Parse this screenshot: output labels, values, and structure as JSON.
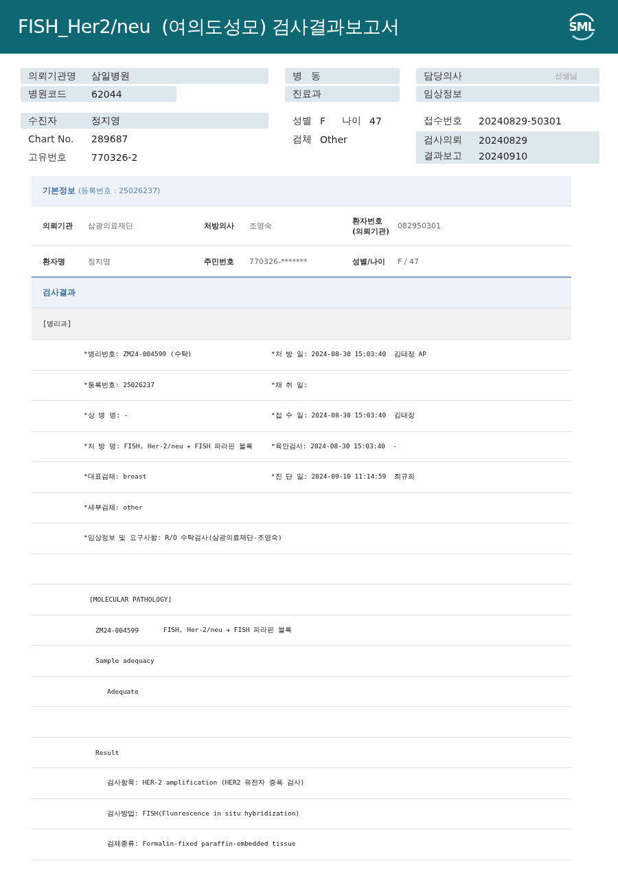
{
  "header": {
    "title": "FISH_Her2/neu  (여의도성모) 검사결과보고서",
    "logo": "SML"
  },
  "info": {
    "columns": [
      [
        {
          "kind": "pill",
          "pairs": [
            {
              "label": "의뢰기관명",
              "value": "삼일병원"
            }
          ]
        },
        {
          "kind": "short-pill",
          "pairs": [
            {
              "label": "병원코드",
              "value": "62044"
            }
          ]
        },
        {
          "kind": "pill",
          "pairs": [
            {
              "label": "수진자",
              "value": "정지영"
            }
          ]
        },
        {
          "kind": "plain",
          "pairs": [
            {
              "label": "Chart No.",
              "value": "289687"
            }
          ]
        },
        {
          "kind": "plain",
          "pairs": [
            {
              "label": "고유번호",
              "value": "770326-2"
            }
          ]
        }
      ],
      [
        {
          "kind": "pill",
          "pairs": [
            {
              "label": "병   동"
            }
          ]
        },
        {
          "kind": "pill",
          "pairs": [
            {
              "label": "진료과"
            }
          ]
        },
        {
          "kind": "plain",
          "pairs": [
            {
              "label": "성별",
              "value": "F"
            },
            {
              "label": "나이",
              "value": "47"
            }
          ]
        },
        {
          "kind": "plain",
          "pairs": [
            {
              "label": "검체",
              "value": "Other"
            }
          ]
        }
      ],
      [
        {
          "kind": "pill",
          "pairs": [
            {
              "label": "담당의사"
            }
          ],
          "note": "선생님"
        },
        {
          "kind": "pill",
          "pairs": [
            {
              "label": "임상정보"
            }
          ]
        },
        {
          "kind": "plain",
          "pairs": [
            {
              "label": "접수번호",
              "value": "20240829-50301"
            }
          ]
        },
        {
          "kind": "pill-group",
          "pairs": [
            {
              "label": "검사의뢰",
              "value": "20240829"
            },
            {
              "label": "결과보고",
              "value": "20240910"
            }
          ]
        }
      ]
    ]
  },
  "basic": {
    "title": "기본정보",
    "subtitle": "(등록번호 : 25026237)",
    "rows": [
      [
        {
          "label": "의뢰기관",
          "value": "삼광의료재단"
        },
        {
          "label": "처방의사",
          "value": "조영숙"
        },
        {
          "label": "환자번호 (의뢰기관)",
          "value": "082950301"
        }
      ],
      [
        {
          "label": "환자명",
          "value": "정지영"
        },
        {
          "label": "주민번호",
          "value": "770326-*******"
        },
        {
          "label": "성별/나이",
          "value": "F / 47"
        }
      ]
    ]
  },
  "results": {
    "title": "검사결과",
    "department": "[병리과]",
    "lines": [
      {
        "kind": "field",
        "texts": [
          "*병리번호: ZM24-004599 (수탁)",
          "*처 방 일: 2024-08-30 15:03:40  김태정 AP"
        ]
      },
      {
        "kind": "field",
        "texts": [
          "*등록번호: 25026237",
          "*채 취 일:"
        ]
      },
      {
        "kind": "field",
        "texts": [
          "*상 병 명: -",
          "*접 수 일: 2024-08-30 15:03:40  김태정"
        ]
      },
      {
        "kind": "field",
        "texts": [
          "*처 방 명: FISH, Her-2/neu + FISH 파라핀 블록",
          "*육안검사: 2024-08-30 15:03:40  -"
        ]
      },
      {
        "kind": "field",
        "texts": [
          "*대표검체: breast",
          "*진 단 일: 2024-09-10 11:14:59  최규희"
        ]
      },
      {
        "kind": "field",
        "texts": [
          "*세부검체: other"
        ]
      },
      {
        "kind": "field",
        "texts": [
          "*임상정보 및 요구사항: R/O 수탁검사(삼광의료재단-조영숙)"
        ]
      },
      {
        "kind": "blank"
      },
      {
        "kind": "heading",
        "texts": [
          "[MOLECULAR PATHOLOGY]"
        ]
      },
      {
        "kind": "entry",
        "texts": [
          "ZM24-004599",
          "FISH, Her-2/neu + FISH 파라핀 블록"
        ]
      },
      {
        "kind": "entry",
        "texts": [
          "Sample adequacy"
        ]
      },
      {
        "kind": "detail",
        "texts": [
          "Adequate"
        ]
      },
      {
        "kind": "blank"
      },
      {
        "kind": "entry",
        "texts": [
          "Result"
        ]
      },
      {
        "kind": "detail",
        "texts": [
          "검사항목: HER-2 amplification (HER2 유전자 증폭 검사)"
        ]
      },
      {
        "kind": "detail",
        "texts": [
          "검사방법: FISH(Fluorescence in situ hybridization)"
        ]
      },
      {
        "kind": "detail",
        "texts": [
          "검체종류: Formalin-fixed paraffin-embedded tissue"
        ]
      }
    ]
  }
}
